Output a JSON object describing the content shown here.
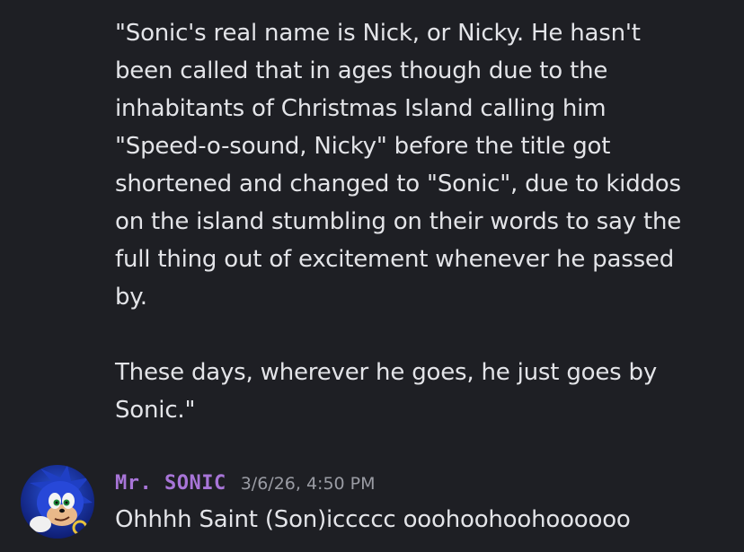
{
  "previous_message": {
    "paragraph_1": [
      "\"Sonic's real name is Nick, or Nicky. He hasn't",
      "been called that in ages though due to the",
      "inhabitants of Christmas Island calling him",
      "\"Speed-o-sound, Nicky\" before the title got",
      "shortened and changed to \"Sonic\", due to kiddos",
      "on the island stumbling on their words to say the",
      "full thing out of excitement whenever he passed",
      "by."
    ],
    "paragraph_2": [
      "These days, wherever he goes, he just goes by",
      "Sonic.\""
    ]
  },
  "message": {
    "avatar_icon": "sonic-avatar-icon",
    "username": "Mr. SONIC",
    "username_color": "#a875d8",
    "timestamp": "3/6/26, 4:50 PM",
    "content": "Ohhhh Saint (Son)iccccc ooohoohoohoooooo"
  },
  "colors": {
    "background": "#1e1f24",
    "text": "#e3e4e8",
    "timestamp": "#9a9ca4"
  }
}
